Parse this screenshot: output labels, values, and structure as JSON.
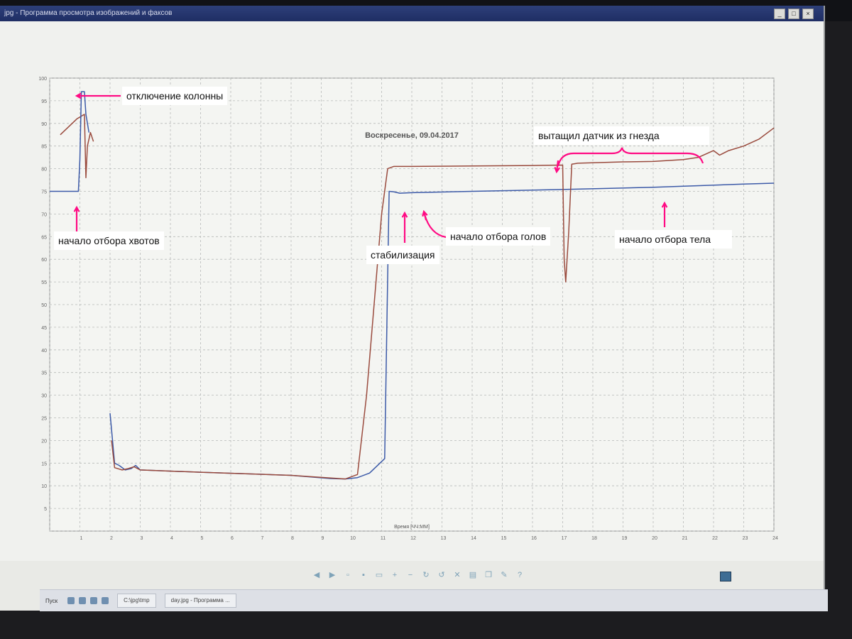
{
  "window": {
    "title": "day.jpg - Программа просмотра изображений и факсов",
    "title_visible": "jpg - Программа просмотра изображений и факсов",
    "buttons": {
      "minimize": "_",
      "maximize": "□",
      "close": "×"
    }
  },
  "chart_data": {
    "type": "line",
    "title": "Воскресенье, 09.04.2017",
    "xlabel": "Время [ЧЧ:ММ]",
    "ylabel": "",
    "xlim": [
      0,
      24
    ],
    "ylim": [
      0,
      100
    ],
    "x_ticks": [
      "1",
      "2",
      "3",
      "4",
      "5",
      "6",
      "7",
      "8",
      "9",
      "10",
      "11",
      "12",
      "13",
      "14",
      "15",
      "16",
      "17",
      "18",
      "19",
      "20",
      "21",
      "22",
      "23",
      "24"
    ],
    "y_ticks": [
      "100",
      "95",
      "90",
      "85",
      "80",
      "75",
      "70",
      "65",
      "60",
      "55",
      "50",
      "45",
      "40",
      "35",
      "30",
      "25",
      "20",
      "15",
      "10",
      "5"
    ],
    "grid": true,
    "series": [
      {
        "color": "#9a4b3e",
        "points": [
          [
            0.35,
            87.5
          ],
          [
            0.9,
            91
          ],
          [
            1.15,
            92
          ],
          [
            1.2,
            78
          ],
          [
            1.25,
            85
          ],
          [
            1.35,
            88
          ],
          [
            1.45,
            86
          ]
        ]
      },
      {
        "color": "#3c5aa8",
        "points": [
          [
            0,
            75
          ],
          [
            0.6,
            75
          ],
          [
            0.95,
            75
          ],
          [
            1.0,
            82
          ],
          [
            1.05,
            97
          ],
          [
            1.15,
            97
          ],
          [
            1.2,
            92
          ],
          [
            1.3,
            88
          ]
        ]
      },
      {
        "color": "#3c5aa8",
        "points": [
          [
            2.0,
            26
          ],
          [
            2.15,
            15
          ],
          [
            2.3,
            14.5
          ],
          [
            2.5,
            13.5
          ],
          [
            2.7,
            13.8
          ],
          [
            2.85,
            14.5
          ],
          [
            3.0,
            13.5
          ],
          [
            5,
            13
          ],
          [
            8,
            12.3
          ],
          [
            9.3,
            11.6
          ],
          [
            9.8,
            11.5
          ],
          [
            10.2,
            11.8
          ],
          [
            10.6,
            12.8
          ],
          [
            11.1,
            16
          ],
          [
            11.2,
            56
          ],
          [
            11.25,
            75
          ],
          [
            11.4,
            74.9
          ],
          [
            11.6,
            74.6
          ],
          [
            12,
            74.7
          ],
          [
            14,
            75
          ],
          [
            17,
            75.4
          ],
          [
            20,
            75.9
          ],
          [
            23,
            76.6
          ],
          [
            24,
            76.8
          ]
        ]
      },
      {
        "color": "#9a4b3e",
        "points": [
          [
            2.05,
            20
          ],
          [
            2.15,
            14
          ],
          [
            2.4,
            13.5
          ],
          [
            2.6,
            13.8
          ],
          [
            2.8,
            14.2
          ],
          [
            3.0,
            13.5
          ],
          [
            5,
            13
          ],
          [
            8,
            12.3
          ],
          [
            9.8,
            11.5
          ],
          [
            10.2,
            12.5
          ],
          [
            10.5,
            30
          ],
          [
            11,
            70
          ],
          [
            11.2,
            80
          ],
          [
            11.4,
            80.5
          ],
          [
            12,
            80.5
          ],
          [
            14,
            80.6
          ],
          [
            16,
            80.7
          ],
          [
            17.0,
            80.8
          ],
          [
            17.05,
            60
          ],
          [
            17.1,
            55
          ],
          [
            17.2,
            66
          ],
          [
            17.3,
            81
          ],
          [
            17.5,
            81.2
          ],
          [
            19,
            81.5
          ],
          [
            20,
            81.6
          ],
          [
            21,
            82
          ],
          [
            21.5,
            82.5
          ],
          [
            22,
            84
          ],
          [
            22.2,
            83
          ],
          [
            22.5,
            84
          ],
          [
            23,
            85
          ],
          [
            23.5,
            86.5
          ],
          [
            24,
            89
          ]
        ]
      }
    ]
  },
  "annotations": [
    {
      "id": "column_off",
      "text": "отключение колонны"
    },
    {
      "id": "tails_start",
      "text": "начало отбора хвотов"
    },
    {
      "id": "stabilization",
      "text": "стабилизация"
    },
    {
      "id": "heads_start",
      "text": "начало отбора голов"
    },
    {
      "id": "sensor_pulled",
      "text": "вытащил датчик из гнезда"
    },
    {
      "id": "body_start",
      "text": "начало отбора тела"
    }
  ],
  "annotation_color": "#ff0a83",
  "viewer_toolbar": {
    "icons": [
      "prev-icon",
      "next-icon",
      "best-fit-icon",
      "actual-size-icon",
      "slideshow-icon",
      "zoom-in-icon",
      "zoom-out-icon",
      "rotate-cw-icon",
      "rotate-ccw-icon",
      "delete-icon",
      "print-icon",
      "copy-icon",
      "edit-icon",
      "help-icon"
    ]
  },
  "taskbar": {
    "start_label": "Пуск",
    "items": [
      "C:\\jpg\\tmp",
      "day.jpg - Программа ..."
    ]
  }
}
